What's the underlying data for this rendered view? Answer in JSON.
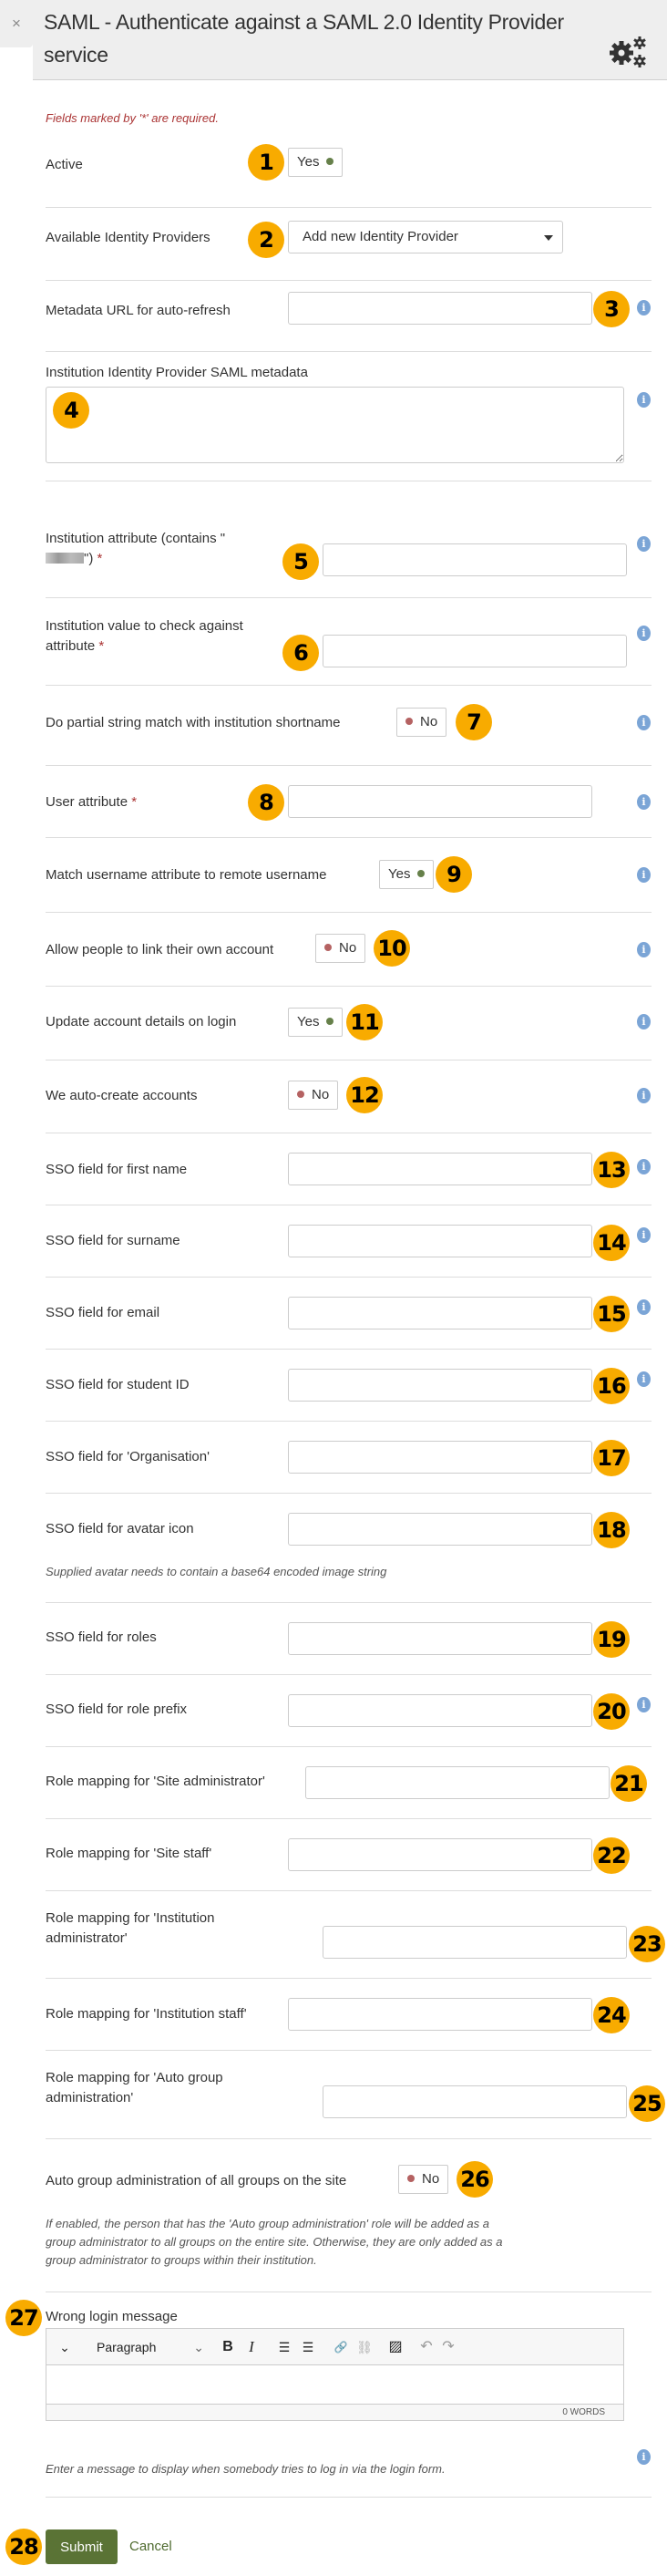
{
  "dialog": {
    "close_label": "×",
    "title": "SAML - Authenticate against a SAML 2.0 Identity Provider service",
    "settings_icon": "gears-icon",
    "required_note": "Fields marked by '*' are required."
  },
  "colors": {
    "badge": "#f8ab00",
    "toggle_on_dot": "#66804a",
    "toggle_off_dot": "#b56262",
    "info_icon": "#7ba5d6",
    "submit_bg": "#5a7335",
    "required_text": "#aa3333"
  },
  "fields": {
    "active": {
      "label": "Active",
      "value": "Yes",
      "state": true,
      "badge": "1"
    },
    "idps": {
      "label": "Available Identity Providers",
      "selected": "Add new Identity Provider",
      "badge": "2"
    },
    "metadata_url": {
      "label": "Metadata URL for auto-refresh",
      "value": "",
      "badge": "3"
    },
    "saml_metadata": {
      "label": "Institution Identity Provider SAML metadata",
      "value": "",
      "badge": "4"
    },
    "inst_attr": {
      "label_prefix": "Institution attribute (contains \"",
      "label_suffix": "\")",
      "required": "*",
      "value": "",
      "badge": "5"
    },
    "inst_value": {
      "label_line1": "Institution value to check against",
      "label_line2": "attribute",
      "required": "*",
      "value": "",
      "badge": "6"
    },
    "partial_match": {
      "label": "Do partial string match with institution shortname",
      "value": "No",
      "state": false,
      "badge": "7"
    },
    "user_attr": {
      "label": "User attribute",
      "required": "*",
      "value": "",
      "badge": "8"
    },
    "match_username": {
      "label": "Match username attribute to remote username",
      "value": "Yes",
      "state": true,
      "badge": "9"
    },
    "link_account": {
      "label": "Allow people to link their own account",
      "value": "No",
      "state": false,
      "badge": "10"
    },
    "update_details": {
      "label": "Update account details on login",
      "value": "Yes",
      "state": true,
      "badge": "11"
    },
    "auto_create": {
      "label": "We auto-create accounts",
      "value": "No",
      "state": false,
      "badge": "12"
    },
    "sso_firstname": {
      "label": "SSO field for first name",
      "value": "",
      "badge": "13"
    },
    "sso_surname": {
      "label": "SSO field for surname",
      "value": "",
      "badge": "14"
    },
    "sso_email": {
      "label": "SSO field for email",
      "value": "",
      "badge": "15"
    },
    "sso_studentid": {
      "label": "SSO field for student ID",
      "value": "",
      "badge": "16"
    },
    "sso_org": {
      "label": "SSO field for 'Organisation'",
      "value": "",
      "badge": "17"
    },
    "sso_avatar": {
      "label": "SSO field for avatar icon",
      "value": "",
      "badge": "18",
      "help": "Supplied avatar needs to contain a base64 encoded image string"
    },
    "sso_roles": {
      "label": "SSO field for roles",
      "value": "",
      "badge": "19"
    },
    "sso_roleprefix": {
      "label": "SSO field for role prefix",
      "value": "",
      "badge": "20"
    },
    "role_siteadmin": {
      "label": "Role mapping for 'Site administrator'",
      "value": "",
      "badge": "21"
    },
    "role_sitestaff": {
      "label": "Role mapping for 'Site staff'",
      "value": "",
      "badge": "22"
    },
    "role_instadmin": {
      "label_line1": "Role mapping for 'Institution",
      "label_line2": "administrator'",
      "value": "",
      "badge": "23"
    },
    "role_inststaff": {
      "label": "Role mapping for 'Institution staff'",
      "value": "",
      "badge": "24"
    },
    "role_autogroup": {
      "label_line1": "Role mapping for 'Auto group",
      "label_line2": "administration'",
      "value": "",
      "badge": "25"
    },
    "autogroup_all": {
      "label": "Auto group administration of all groups on the site",
      "value": "No",
      "state": false,
      "badge": "26",
      "help_lines": [
        "If enabled, the person that has the 'Auto group administration' role will be added as a",
        "group administrator to all groups on the entire site. Otherwise, they are only added as a",
        "group administrator to groups within their institution."
      ]
    },
    "wrong_login": {
      "label": "Wrong login message",
      "badge": "27",
      "toolbar": {
        "collapse": "⌄",
        "format": "Paragraph",
        "format_caret": "⌄",
        "bold": "B",
        "italic": "I",
        "bullet_list": "☰",
        "numbered_list": "☰",
        "link": "🔗",
        "unlink": "⛓",
        "image": "▨",
        "undo": "↶",
        "redo": "↷"
      },
      "word_count": "0 WORDS",
      "help": "Enter a message to display when somebody tries to log in via the login form."
    }
  },
  "actions": {
    "submit": "Submit",
    "cancel": "Cancel",
    "badge": "28"
  },
  "info_glyph": "i"
}
